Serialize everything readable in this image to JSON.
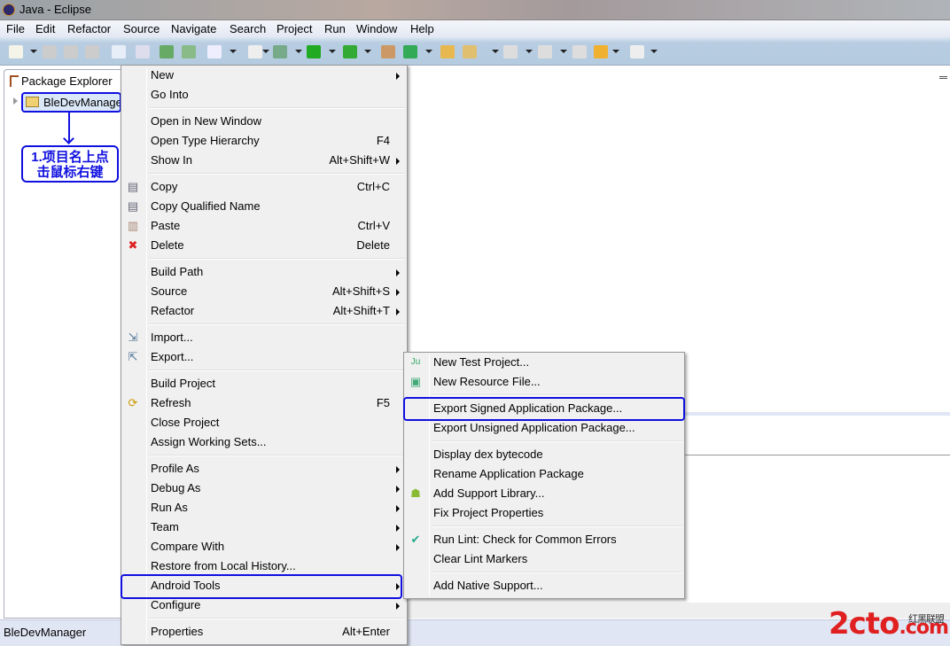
{
  "window": {
    "title": "Java - Eclipse"
  },
  "menubar": [
    "File",
    "Edit",
    "Refactor",
    "Source",
    "Navigate",
    "Search",
    "Project",
    "Run",
    "Window",
    "Help"
  ],
  "package_explorer": {
    "title": "Package Explorer",
    "project": "BleDevManager"
  },
  "annotation": {
    "line1": "1.项目名上点",
    "line2": "击鼠标右键"
  },
  "context_menu": [
    {
      "label": "New",
      "submenu": true
    },
    {
      "label": "Go Into"
    },
    {
      "sep": true
    },
    {
      "label": "Open in New Window"
    },
    {
      "label": "Open Type Hierarchy",
      "shortcut": "F4"
    },
    {
      "label": "Show In",
      "shortcut": "Alt+Shift+W",
      "submenu": true
    },
    {
      "sep": true
    },
    {
      "label": "Copy",
      "shortcut": "Ctrl+C",
      "icon": "copy-icon"
    },
    {
      "label": "Copy Qualified Name",
      "icon": "copy-qualified-icon"
    },
    {
      "label": "Paste",
      "shortcut": "Ctrl+V",
      "icon": "paste-icon"
    },
    {
      "label": "Delete",
      "shortcut": "Delete",
      "icon": "delete-icon"
    },
    {
      "sep": true
    },
    {
      "label": "Build Path",
      "submenu": true
    },
    {
      "label": "Source",
      "shortcut": "Alt+Shift+S",
      "submenu": true
    },
    {
      "label": "Refactor",
      "shortcut": "Alt+Shift+T",
      "submenu": true
    },
    {
      "sep": true
    },
    {
      "label": "Import...",
      "icon": "import-icon"
    },
    {
      "label": "Export...",
      "icon": "export-icon"
    },
    {
      "sep": true
    },
    {
      "label": "Build Project"
    },
    {
      "label": "Refresh",
      "shortcut": "F5",
      "icon": "refresh-icon"
    },
    {
      "label": "Close Project"
    },
    {
      "label": "Assign Working Sets..."
    },
    {
      "sep": true
    },
    {
      "label": "Profile As",
      "submenu": true
    },
    {
      "label": "Debug As",
      "submenu": true
    },
    {
      "label": "Run As",
      "submenu": true
    },
    {
      "label": "Team",
      "submenu": true
    },
    {
      "label": "Compare With",
      "submenu": true
    },
    {
      "label": "Restore from Local History..."
    },
    {
      "label": "Android Tools",
      "submenu": true,
      "highlighted": true
    },
    {
      "label": "Configure",
      "submenu": true
    },
    {
      "sep": true
    },
    {
      "label": "Properties",
      "shortcut": "Alt+Enter"
    }
  ],
  "submenu": [
    {
      "label": "New Test Project...",
      "icon": "junit-icon"
    },
    {
      "label": "New Resource File...",
      "icon": "new-resource-icon"
    },
    {
      "sep": true
    },
    {
      "label": "Export Signed Application Package...",
      "highlighted": true
    },
    {
      "label": "Export Unsigned Application Package..."
    },
    {
      "sep": true
    },
    {
      "label": "Display dex bytecode"
    },
    {
      "label": "Rename Application Package"
    },
    {
      "label": "Add Support Library...",
      "icon": "android-icon"
    },
    {
      "label": "Fix Project Properties"
    },
    {
      "sep": true
    },
    {
      "label": "Run Lint: Check for Common Errors",
      "icon": "check-icon"
    },
    {
      "label": "Clear Lint Markers"
    },
    {
      "sep": true
    },
    {
      "label": "Add Native Support..."
    }
  ],
  "status": {
    "text": "BleDevManager"
  },
  "watermark": {
    "logo": "2cto.com",
    "tagline": "红黑联盟"
  }
}
